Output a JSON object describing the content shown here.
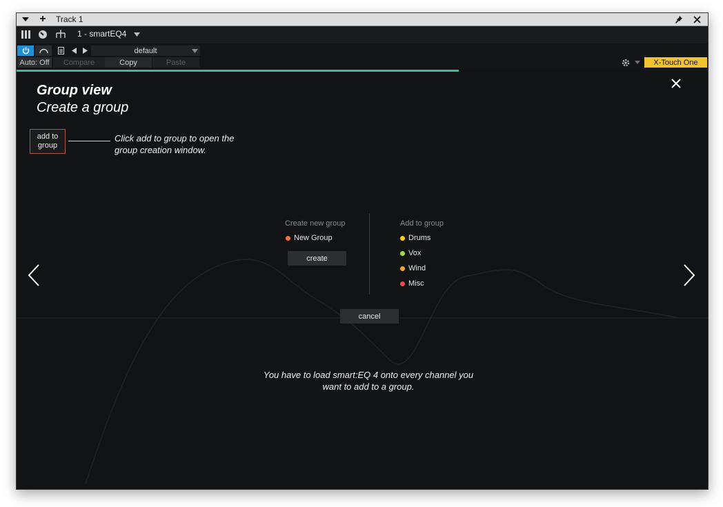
{
  "window": {
    "title": "Track 1"
  },
  "plugin_bar": {
    "plugin_name": "1 - smartEQ4",
    "preset": "default",
    "auto_label": "Auto: Off",
    "compare_label": "Compare",
    "copy_label": "Copy",
    "paste_label": "Paste",
    "controller_label": "X-Touch One"
  },
  "tutorial": {
    "title": "Group view",
    "subtitle": "Create a group",
    "add_button_label": "add to\ngroup",
    "hint": "Click add to group to open the group creation window.",
    "note": "You have to load smart:EQ 4 onto every channel you want to add to a group.",
    "progress": 0.64
  },
  "group_dialog": {
    "create_header": "Create new group",
    "new_group": "New Group",
    "new_group_color": "#e8734a",
    "create_label": "create",
    "add_header": "Add to group",
    "groups": [
      {
        "name": "Drums",
        "color": "#f2d21b"
      },
      {
        "name": "Vox",
        "color": "#a8d64a"
      },
      {
        "name": "Wind",
        "color": "#f0a43a"
      },
      {
        "name": "Misc",
        "color": "#e84b5a"
      }
    ],
    "cancel_label": "cancel"
  },
  "colors": {
    "accent_teal": "#2fbf9c",
    "power_blue": "#1f8fd6",
    "controller_yellow": "#f2c230"
  }
}
